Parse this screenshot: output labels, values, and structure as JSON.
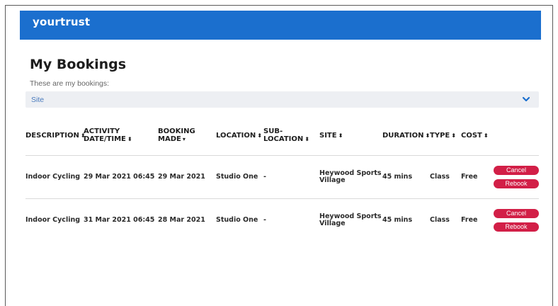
{
  "app": {
    "logo": "yourtrust"
  },
  "page": {
    "title": "My Bookings",
    "subtitle": "These are my bookings:"
  },
  "filter": {
    "site_label": "Site",
    "icon": "chevron-down-icon"
  },
  "table": {
    "headers": {
      "description": "DESCRIPTION",
      "activity_line1": "ACTIVITY",
      "activity_line2": "DATE/TIME",
      "booking_line1": "BOOKING",
      "booking_line2": "MADE",
      "location": "LOCATION",
      "sublocation_line1": "SUB-",
      "sublocation_line2": "LOCATION",
      "site": "SITE",
      "duration": "DURATION",
      "type": "TYPE",
      "cost": "COST"
    },
    "sort_icon": "⬍",
    "sort_desc_icon": "▾",
    "rows": [
      {
        "description": "Indoor Cycling",
        "activity_datetime": "29 Mar 2021 06:45",
        "booking_made": "29 Mar 2021",
        "location": "Studio One",
        "sublocation": "-",
        "site_line1": "Heywood Sports",
        "site_line2": "Village",
        "duration": "45 mins",
        "type": "Class",
        "cost": "Free",
        "cancel_label": "Cancel",
        "rebook_label": "Rebook"
      },
      {
        "description": "Indoor Cycling",
        "activity_datetime": "31 Mar 2021 06:45",
        "booking_made": "28 Mar 2021",
        "location": "Studio One",
        "sublocation": "-",
        "site_line1": "Heywood Sports",
        "site_line2": "Village",
        "duration": "45 mins",
        "type": "Class",
        "cost": "Free",
        "cancel_label": "Cancel",
        "rebook_label": "Rebook"
      }
    ]
  },
  "colors": {
    "brand": "#1b6fce",
    "danger": "#d21f47",
    "filter_bg": "#edeff3"
  }
}
